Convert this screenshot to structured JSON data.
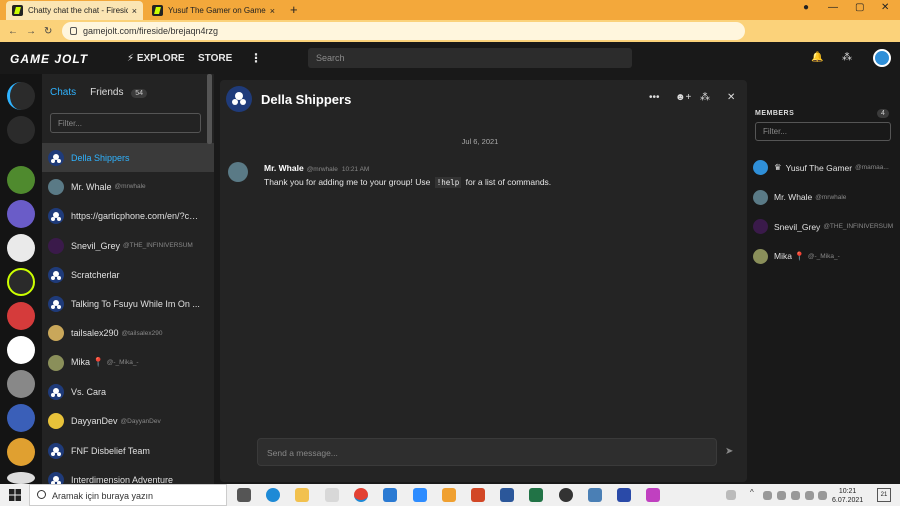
{
  "browser": {
    "tabs": [
      {
        "title": "Chatty chat the chat - Fireside - G",
        "close": "×"
      },
      {
        "title": "Yusuf The Gamer on Game Jolt:",
        "close": "×"
      }
    ],
    "new_tab": "+",
    "url": "gamejolt.com/fireside/brejaqn4rzg",
    "window_controls": [
      "—",
      "▢",
      "✕"
    ]
  },
  "header": {
    "logo": "GAME JOLT",
    "explore": "EXPLORE",
    "store": "STORE",
    "more": "⋮",
    "search_placeholder": "Search"
  },
  "chats_panel": {
    "tab_chats": "Chats",
    "tab_friends": "Friends",
    "friends_count": "54",
    "filter_placeholder": "Filter...",
    "items": [
      {
        "name": "Della Shippers",
        "handle": "",
        "type": "group",
        "selected": true
      },
      {
        "name": "Mr. Whale",
        "handle": "@mrwhale",
        "type": "user"
      },
      {
        "name": "https://garticphone.com/en/?c=...",
        "handle": "",
        "type": "group"
      },
      {
        "name": "Snevil_Grey",
        "handle": "@THE_INFINIVERSUM",
        "type": "user"
      },
      {
        "name": "Scratcherlar",
        "handle": "",
        "type": "group"
      },
      {
        "name": "Talking To Fsuyu While Im On ...",
        "handle": "",
        "type": "group"
      },
      {
        "name": "tailsalex290",
        "handle": "@tailsalex290",
        "type": "user"
      },
      {
        "name": "Mika 📍",
        "handle": "@-_Mika_-",
        "type": "user"
      },
      {
        "name": "Vs. Cara",
        "handle": "",
        "type": "group"
      },
      {
        "name": "DayyanDev",
        "handle": "@DayyanDev",
        "type": "user"
      },
      {
        "name": "FNF Disbelief Team",
        "handle": "",
        "type": "group"
      },
      {
        "name": "Interdimension Adventure",
        "handle": "",
        "type": "group"
      }
    ]
  },
  "room": {
    "title": "Della Shippers",
    "date_divider": "Jul 6, 2021",
    "message": {
      "author": "Mr. Whale",
      "handle": "@mrwhale",
      "time": "10:21 AM",
      "text_before": "Thank you for adding me to your group! Use",
      "code": "!help",
      "text_after": "for a list of commands."
    },
    "send_placeholder": "Send a message..."
  },
  "members": {
    "heading": "MEMBERS",
    "count": "4",
    "filter_placeholder": "Filter...",
    "items": [
      {
        "name": "Yusuf The Gamer",
        "handle": "@mamaa...",
        "prefix": "♛"
      },
      {
        "name": "Mr. Whale",
        "handle": "@mrwhale",
        "prefix": ""
      },
      {
        "name": "Snevil_Grey",
        "handle": "@THE_INFINIVERSUM",
        "prefix": ""
      },
      {
        "name": "Mika 📍",
        "handle": "@-_Mika_-",
        "prefix": ""
      }
    ]
  },
  "taskbar": {
    "search_text": "Aramak için buraya yazın",
    "time": "10:21",
    "date": "6.07.2021",
    "notification_count": "21"
  }
}
